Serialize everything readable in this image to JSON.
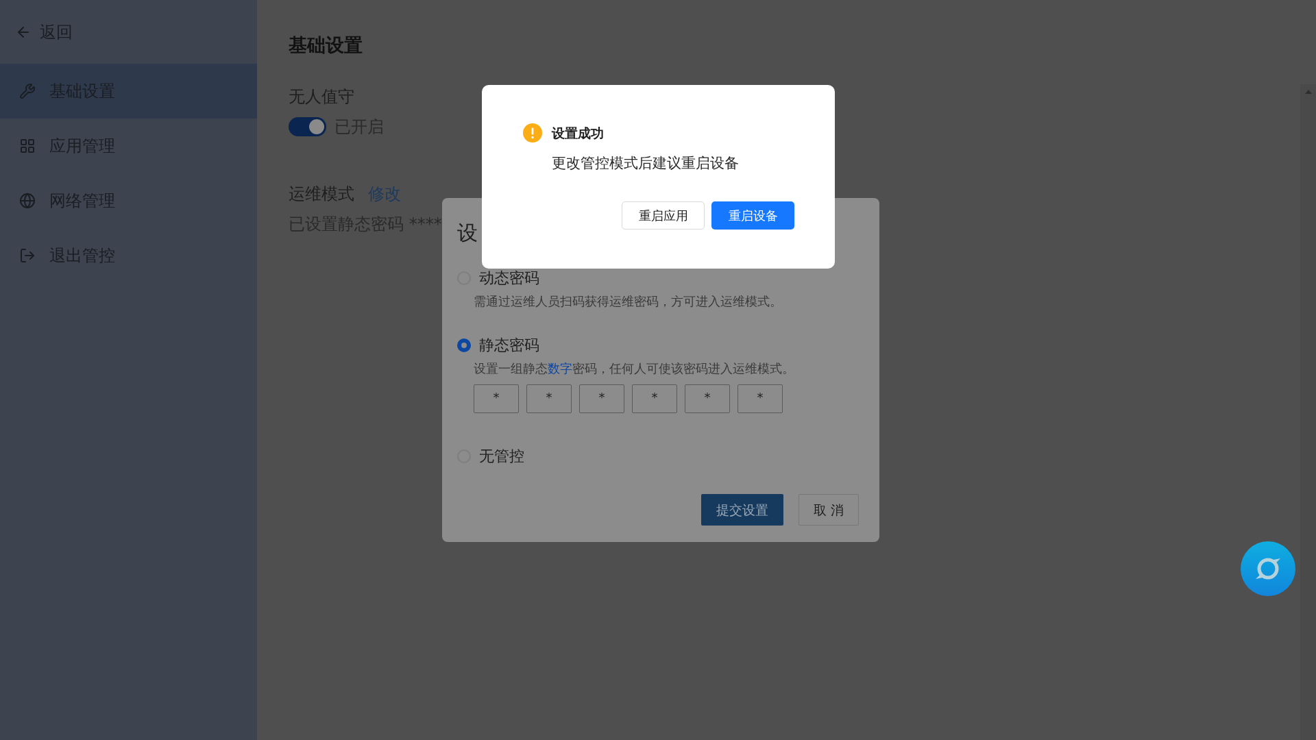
{
  "sidebar": {
    "back": {
      "label": "返回"
    },
    "items": [
      {
        "label": "基础设置",
        "kind": "wrench",
        "selected": true
      },
      {
        "label": "应用管理",
        "kind": "grid",
        "selected": false
      },
      {
        "label": "网络管理",
        "kind": "globe",
        "selected": false
      },
      {
        "label": "退出管控",
        "kind": "exit",
        "selected": false
      }
    ]
  },
  "page": {
    "title": "基础设置",
    "unattended": {
      "label": "无人值守",
      "on": true,
      "status": "已开启"
    },
    "maintenance": {
      "label": "运维模式",
      "edit_link": "修改",
      "summary": "已设置静态密码 ****"
    }
  },
  "settings_dialog": {
    "title": "设",
    "options": [
      {
        "label": "动态密码",
        "selected": false,
        "description": [
          "需通过运维人员扫码获得运维密码，方可进入运维模式。"
        ]
      },
      {
        "label": "静态密码",
        "selected": true,
        "description": [
          "设置一组静态",
          "数字",
          "密码，任何人可使该密码进入运维模式。"
        ],
        "pin": [
          "*",
          "*",
          "*",
          "*",
          "*",
          "*"
        ]
      },
      {
        "label": "无管控",
        "selected": false
      }
    ],
    "buttons": [
      {
        "label": "提交设置",
        "kind": "primary"
      },
      {
        "label": "取 消",
        "kind": "default"
      }
    ]
  },
  "success_dialog": {
    "title": "设置成功",
    "message": "更改管控模式后建议重启设备",
    "buttons": [
      {
        "label": "重启应用",
        "kind": "default"
      },
      {
        "label": "重启设备",
        "kind": "primary"
      }
    ]
  }
}
